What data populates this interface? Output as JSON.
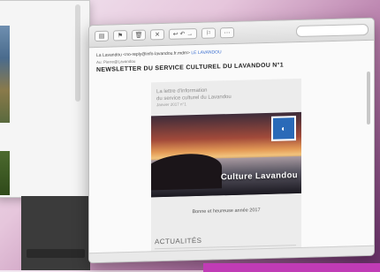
{
  "mail": {
    "from": "La Lavandou <no-reply@info-lavandou.fr.mdm> ",
    "from_link": "LE LAVANDOU",
    "to": "Au: Pierre@Lavandou",
    "subject": "NEWSLETTER DU SERVICE CULTUREL DU LAVANDOU N°1"
  },
  "email": {
    "lettre_line1": "La lettre d'information",
    "lettre_line2": "du service culturel du Lavandou",
    "lettre_date": "Janvier 2017 n°1",
    "hero_caption": "Culture Lavandou",
    "greeting": "Bonne et heureuse année 2017",
    "section_title": "ACTUALITÉS"
  },
  "colors": {
    "accent_link": "#3b6fd0",
    "badge_blue": "#2a6ab8",
    "dock_magenta": "#c03bb5"
  }
}
